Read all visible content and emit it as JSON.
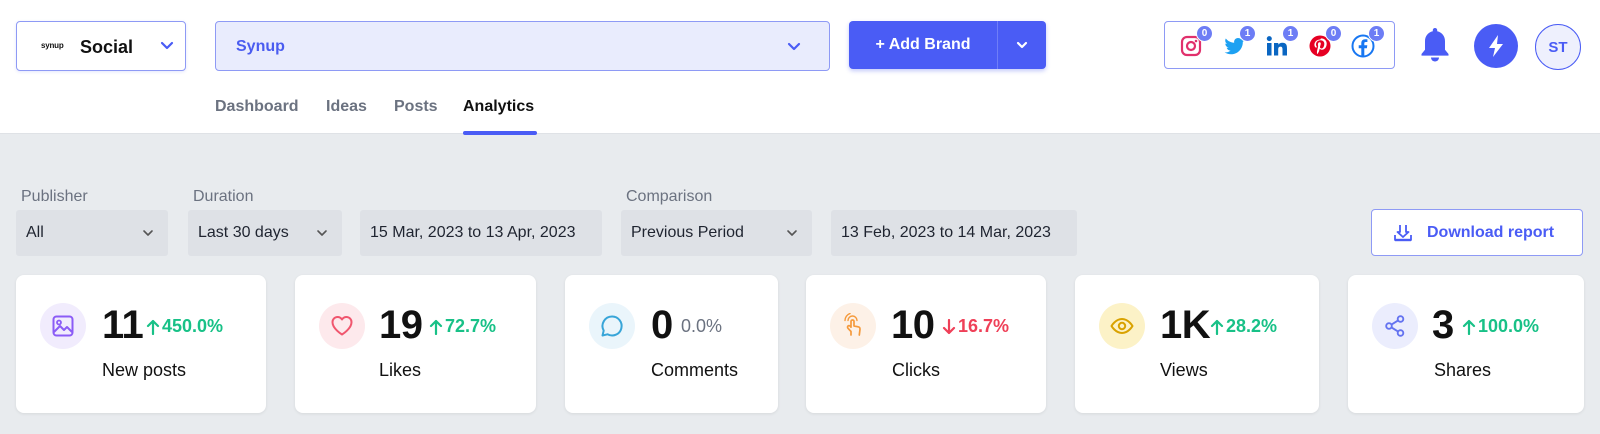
{
  "header": {
    "app_switcher": {
      "logo_text": "synup",
      "label": "Social"
    },
    "brand_select": {
      "value": "Synup"
    },
    "add_brand": {
      "label": "+ Add Brand"
    },
    "social_accounts": [
      {
        "name": "instagram-icon",
        "count": "0",
        "color": "#e1306c"
      },
      {
        "name": "twitter-icon",
        "count": "1",
        "color": "#1da1f2"
      },
      {
        "name": "linkedin-icon",
        "count": "1",
        "color": "#0a66c2"
      },
      {
        "name": "pinterest-icon",
        "count": "0",
        "color": "#e60023"
      },
      {
        "name": "facebook-icon",
        "count": "1",
        "color": "#1877f2"
      }
    ],
    "avatar_initials": "ST",
    "accent": "#4a5cf5"
  },
  "tabs": [
    {
      "label": "Dashboard",
      "active": false
    },
    {
      "label": "Ideas",
      "active": false
    },
    {
      "label": "Posts",
      "active": false
    },
    {
      "label": "Analytics",
      "active": true
    }
  ],
  "filters": {
    "publisher": {
      "label": "Publisher",
      "value": "All"
    },
    "duration": {
      "label": "Duration",
      "value": "Last 30 days",
      "range": "15 Mar, 2023 to 13 Apr, 2023"
    },
    "comparison": {
      "label": "Comparison",
      "value": "Previous Period",
      "range": "13 Feb, 2023 to 14 Mar, 2023"
    }
  },
  "download_report": {
    "label": "Download report"
  },
  "metrics": [
    {
      "icon": "image-icon",
      "value": "11",
      "change": "450.0%",
      "direction": "up",
      "name": "New posts",
      "icon_color": "#8b5cf6",
      "icon_bg": "#f1ecfd"
    },
    {
      "icon": "heart-icon",
      "value": "19",
      "change": "72.7%",
      "direction": "up",
      "name": "Likes",
      "icon_color": "#f0566e",
      "icon_bg": "#fde9ec"
    },
    {
      "icon": "comment-icon",
      "value": "0",
      "change": "0.0%",
      "direction": "neutral",
      "name": "Comments",
      "icon_color": "#38a5d8",
      "icon_bg": "#eaf5fb"
    },
    {
      "icon": "pointer-icon",
      "value": "10",
      "change": "16.7%",
      "direction": "down",
      "name": "Clicks",
      "icon_color": "#f59a3c",
      "icon_bg": "#fdf1e7"
    },
    {
      "icon": "eye-icon",
      "value": "1K",
      "change": "28.2%",
      "direction": "up",
      "name": "Views",
      "icon_color": "#d9a200",
      "icon_bg": "#fcf2c7"
    },
    {
      "icon": "share-icon",
      "value": "3",
      "change": "100.0%",
      "direction": "up",
      "name": "Shares",
      "icon_color": "#6473f0",
      "icon_bg": "#ebedfd"
    }
  ],
  "status_colors": {
    "up": "#18c187",
    "down": "#ef4058",
    "neutral": "#6b7280"
  }
}
